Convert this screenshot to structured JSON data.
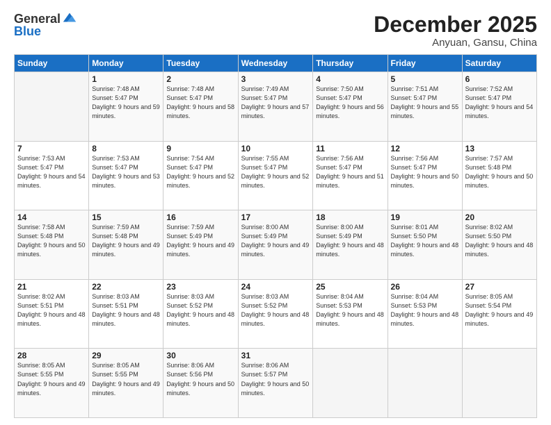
{
  "header": {
    "logo_general": "General",
    "logo_blue": "Blue",
    "month": "December 2025",
    "location": "Anyuan, Gansu, China"
  },
  "weekdays": [
    "Sunday",
    "Monday",
    "Tuesday",
    "Wednesday",
    "Thursday",
    "Friday",
    "Saturday"
  ],
  "weeks": [
    [
      {
        "day": "",
        "empty": true
      },
      {
        "day": "1",
        "sunrise": "7:48 AM",
        "sunset": "5:47 PM",
        "daylight": "9 hours and 59 minutes."
      },
      {
        "day": "2",
        "sunrise": "7:48 AM",
        "sunset": "5:47 PM",
        "daylight": "9 hours and 58 minutes."
      },
      {
        "day": "3",
        "sunrise": "7:49 AM",
        "sunset": "5:47 PM",
        "daylight": "9 hours and 57 minutes."
      },
      {
        "day": "4",
        "sunrise": "7:50 AM",
        "sunset": "5:47 PM",
        "daylight": "9 hours and 56 minutes."
      },
      {
        "day": "5",
        "sunrise": "7:51 AM",
        "sunset": "5:47 PM",
        "daylight": "9 hours and 55 minutes."
      },
      {
        "day": "6",
        "sunrise": "7:52 AM",
        "sunset": "5:47 PM",
        "daylight": "9 hours and 54 minutes."
      }
    ],
    [
      {
        "day": "7",
        "sunrise": "7:53 AM",
        "sunset": "5:47 PM",
        "daylight": "9 hours and 54 minutes."
      },
      {
        "day": "8",
        "sunrise": "7:53 AM",
        "sunset": "5:47 PM",
        "daylight": "9 hours and 53 minutes."
      },
      {
        "day": "9",
        "sunrise": "7:54 AM",
        "sunset": "5:47 PM",
        "daylight": "9 hours and 52 minutes."
      },
      {
        "day": "10",
        "sunrise": "7:55 AM",
        "sunset": "5:47 PM",
        "daylight": "9 hours and 52 minutes."
      },
      {
        "day": "11",
        "sunrise": "7:56 AM",
        "sunset": "5:47 PM",
        "daylight": "9 hours and 51 minutes."
      },
      {
        "day": "12",
        "sunrise": "7:56 AM",
        "sunset": "5:47 PM",
        "daylight": "9 hours and 50 minutes."
      },
      {
        "day": "13",
        "sunrise": "7:57 AM",
        "sunset": "5:48 PM",
        "daylight": "9 hours and 50 minutes."
      }
    ],
    [
      {
        "day": "14",
        "sunrise": "7:58 AM",
        "sunset": "5:48 PM",
        "daylight": "9 hours and 50 minutes."
      },
      {
        "day": "15",
        "sunrise": "7:59 AM",
        "sunset": "5:48 PM",
        "daylight": "9 hours and 49 minutes."
      },
      {
        "day": "16",
        "sunrise": "7:59 AM",
        "sunset": "5:49 PM",
        "daylight": "9 hours and 49 minutes."
      },
      {
        "day": "17",
        "sunrise": "8:00 AM",
        "sunset": "5:49 PM",
        "daylight": "9 hours and 49 minutes."
      },
      {
        "day": "18",
        "sunrise": "8:00 AM",
        "sunset": "5:49 PM",
        "daylight": "9 hours and 48 minutes."
      },
      {
        "day": "19",
        "sunrise": "8:01 AM",
        "sunset": "5:50 PM",
        "daylight": "9 hours and 48 minutes."
      },
      {
        "day": "20",
        "sunrise": "8:02 AM",
        "sunset": "5:50 PM",
        "daylight": "9 hours and 48 minutes."
      }
    ],
    [
      {
        "day": "21",
        "sunrise": "8:02 AM",
        "sunset": "5:51 PM",
        "daylight": "9 hours and 48 minutes."
      },
      {
        "day": "22",
        "sunrise": "8:03 AM",
        "sunset": "5:51 PM",
        "daylight": "9 hours and 48 minutes."
      },
      {
        "day": "23",
        "sunrise": "8:03 AM",
        "sunset": "5:52 PM",
        "daylight": "9 hours and 48 minutes."
      },
      {
        "day": "24",
        "sunrise": "8:03 AM",
        "sunset": "5:52 PM",
        "daylight": "9 hours and 48 minutes."
      },
      {
        "day": "25",
        "sunrise": "8:04 AM",
        "sunset": "5:53 PM",
        "daylight": "9 hours and 48 minutes."
      },
      {
        "day": "26",
        "sunrise": "8:04 AM",
        "sunset": "5:53 PM",
        "daylight": "9 hours and 48 minutes."
      },
      {
        "day": "27",
        "sunrise": "8:05 AM",
        "sunset": "5:54 PM",
        "daylight": "9 hours and 49 minutes."
      }
    ],
    [
      {
        "day": "28",
        "sunrise": "8:05 AM",
        "sunset": "5:55 PM",
        "daylight": "9 hours and 49 minutes."
      },
      {
        "day": "29",
        "sunrise": "8:05 AM",
        "sunset": "5:55 PM",
        "daylight": "9 hours and 49 minutes."
      },
      {
        "day": "30",
        "sunrise": "8:06 AM",
        "sunset": "5:56 PM",
        "daylight": "9 hours and 50 minutes."
      },
      {
        "day": "31",
        "sunrise": "8:06 AM",
        "sunset": "5:57 PM",
        "daylight": "9 hours and 50 minutes."
      },
      {
        "day": "",
        "empty": true
      },
      {
        "day": "",
        "empty": true
      },
      {
        "day": "",
        "empty": true
      }
    ]
  ]
}
